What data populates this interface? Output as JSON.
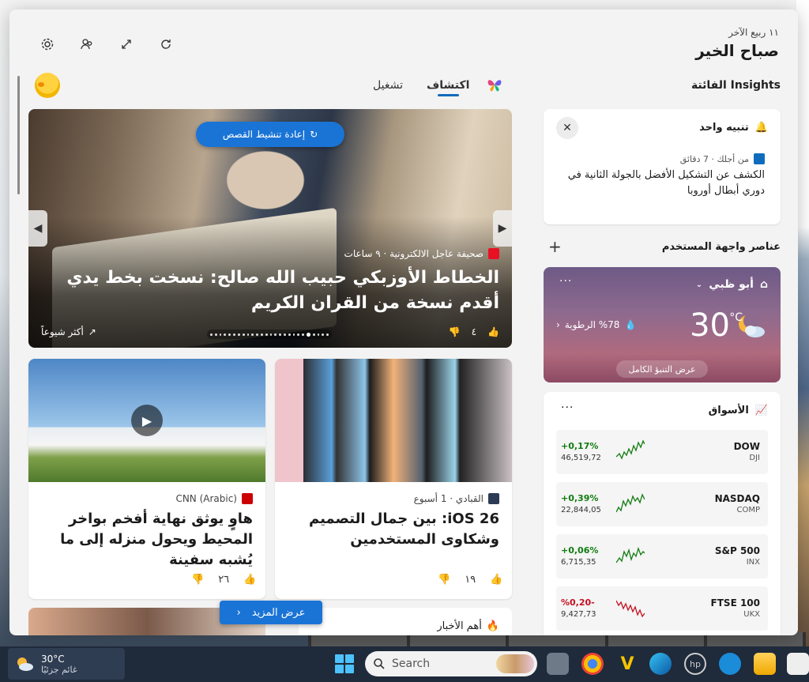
{
  "header": {
    "date": "١١ ربيع الآخر",
    "greeting": "صباح الخير"
  },
  "tabs": [
    {
      "label": "اكتشاف",
      "active": true
    },
    {
      "label": "تشغيل",
      "active": false
    }
  ],
  "hero": {
    "refresh_label": "إعادة تنشيط القصص",
    "source": "صحيفة عاجل الالكترونية · ٩ ساعات",
    "title": "الخطاط الأوزبكي حبيب الله صالح: نسخت بخط يدي أقدم نسخة من القران الكريم",
    "trending_label": "أكثر شيوعاً",
    "likes": "٤"
  },
  "cards": [
    {
      "source": "القبادي · 1 أسبوع",
      "title": "iOS 26: بين جمال التصميم وشكاوى المستخدمين",
      "likes": "١٩"
    },
    {
      "source": "CNN (Arabic)",
      "title": "هاوٍ يوثق نهاية أفخم بواخر المحيط ويحول منزله إلى ما يُشبه سفينة",
      "likes": "٢٦"
    }
  ],
  "show_more_label": "عرض المزيد",
  "top_news_label": "أهم الأخبار",
  "insights": {
    "title": "Insights الفائتة",
    "alert_title": "تنبيه واحد",
    "alert_meta": "من أجلك · 7 دقائق",
    "alert_text": "الكشف عن التشكيل الأفضل بالجولة الثانية في دوري أبطال أوروبا"
  },
  "widgets_title": "عناصر واجهة المستخدم",
  "weather": {
    "location": "أبو ظبي",
    "temp": "30",
    "unit": "°C",
    "humidity": "%78 الرطوبة",
    "forecast_button": "عرض التنبؤ الكامل"
  },
  "markets": {
    "title": "الأسواق",
    "rows": [
      {
        "name": "DOW",
        "ticker": "DJI",
        "change": "+0,17%",
        "value": "46,519,72",
        "trend": "up"
      },
      {
        "name": "NASDAQ",
        "ticker": "COMP",
        "change": "+0,39%",
        "value": "22,844,05",
        "trend": "up"
      },
      {
        "name": "S&P 500",
        "ticker": "INX",
        "change": "+0,06%",
        "value": "6,715,35",
        "trend": "up"
      },
      {
        "name": "FTSE 100",
        "ticker": "UKX",
        "change": "%0,20-",
        "value": "9,427,73",
        "trend": "down"
      }
    ]
  },
  "taskbar": {
    "temp": "30°C",
    "condition": "غائم جزئيًا",
    "search_placeholder": "Search"
  },
  "colors": {
    "accent": "#1a74d6",
    "up": "#107c10",
    "down": "#c50f1f"
  }
}
